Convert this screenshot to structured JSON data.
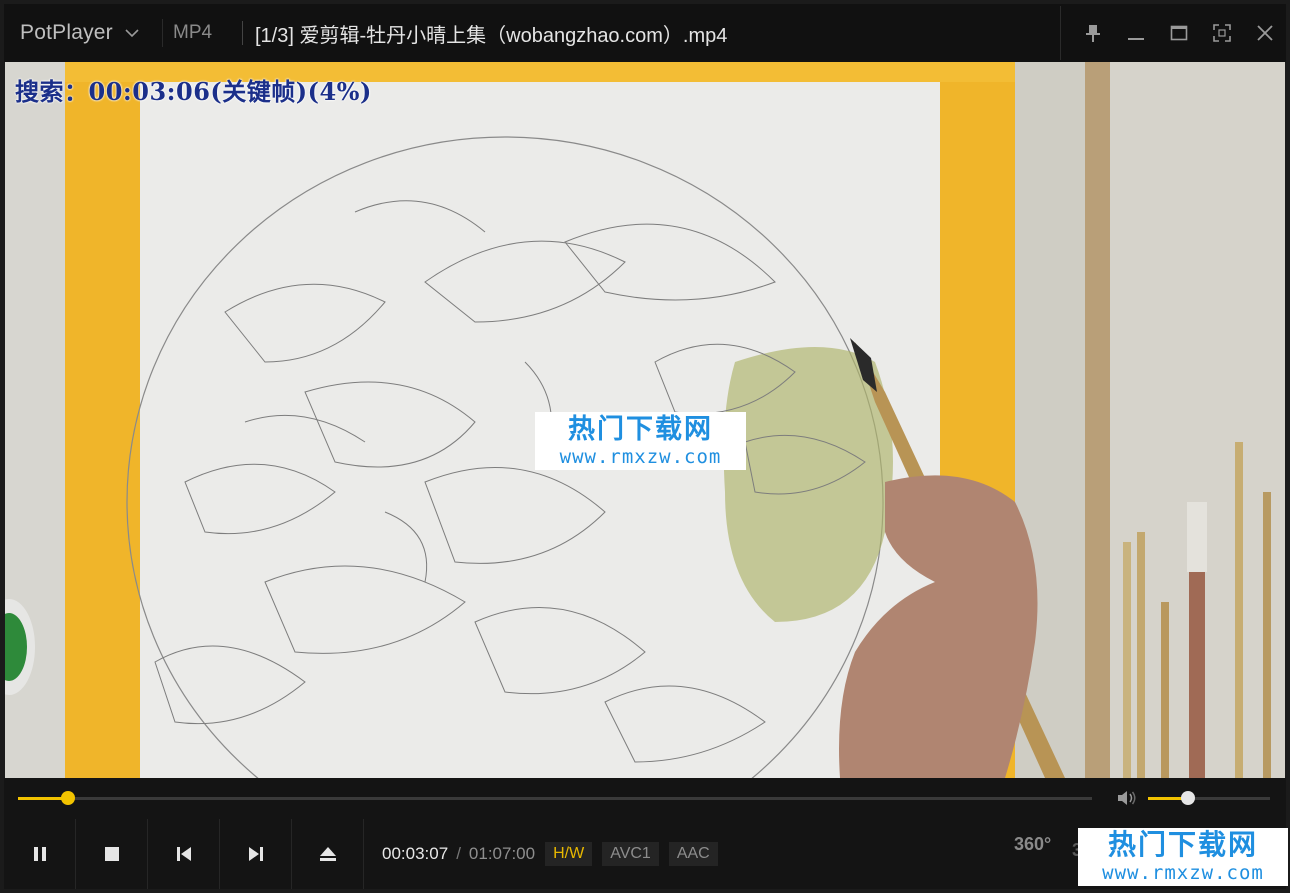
{
  "app": {
    "name": "PotPlayer",
    "format": "MP4",
    "title": "[1/3] 爱剪辑-牡丹小晴上集（wobangzhao.com）.mp4"
  },
  "window_controls": {
    "pin": "pin-icon",
    "minimize": "minimize-icon",
    "maximize": "maximize-icon",
    "fullscreen": "fullscreen-icon",
    "close": "close-icon"
  },
  "video": {
    "osd_text": "搜索：00:03:06(关键帧)(4%)",
    "watermark_cn": "热门下载网",
    "watermark_url": "www.rmxzw.com"
  },
  "seek": {
    "progress_fraction": 0.0462
  },
  "volume": {
    "level_fraction": 0.33
  },
  "controls": {
    "current_time": "00:03:07",
    "separator": "/",
    "total_time": "01:07:00",
    "hw_label": "H/W",
    "video_codec": "AVC1",
    "audio_codec": "AAC",
    "vr_label": "360°",
    "3d_label": "3D"
  },
  "colors": {
    "accent": "#f2c300",
    "watermark": "#1f8fe0",
    "osd": "#1b2f8a"
  }
}
